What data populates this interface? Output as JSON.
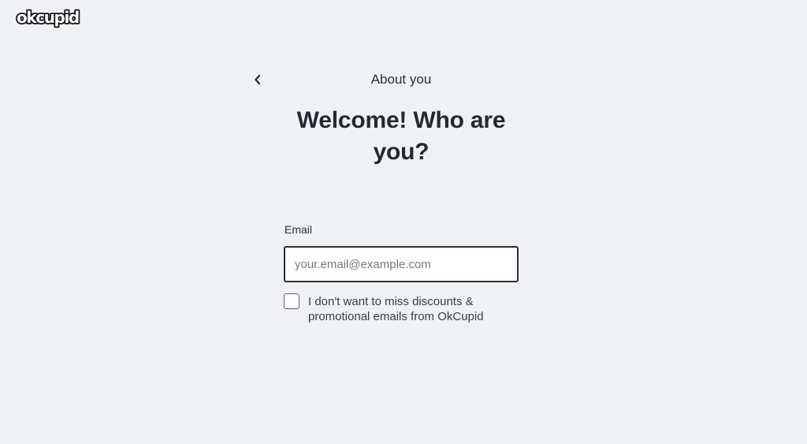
{
  "brand": {
    "logo_text": "okcupid"
  },
  "header": {
    "back_icon": "chevron-left-icon",
    "step_title": "About you"
  },
  "main": {
    "title_line1": "Welcome! Who are",
    "title_line2": "you?",
    "email": {
      "label": "Email",
      "placeholder": "your.email@example.com",
      "value": ""
    },
    "promo_opt_in": {
      "label": "I don't want to miss discounts & promotional emails from OkCupid",
      "checked": false
    }
  },
  "colors": {
    "background": "#f0f1f5",
    "text": "#242a33",
    "checkbox_border": "#5b4fb6",
    "input_border": "#2a2d33"
  }
}
